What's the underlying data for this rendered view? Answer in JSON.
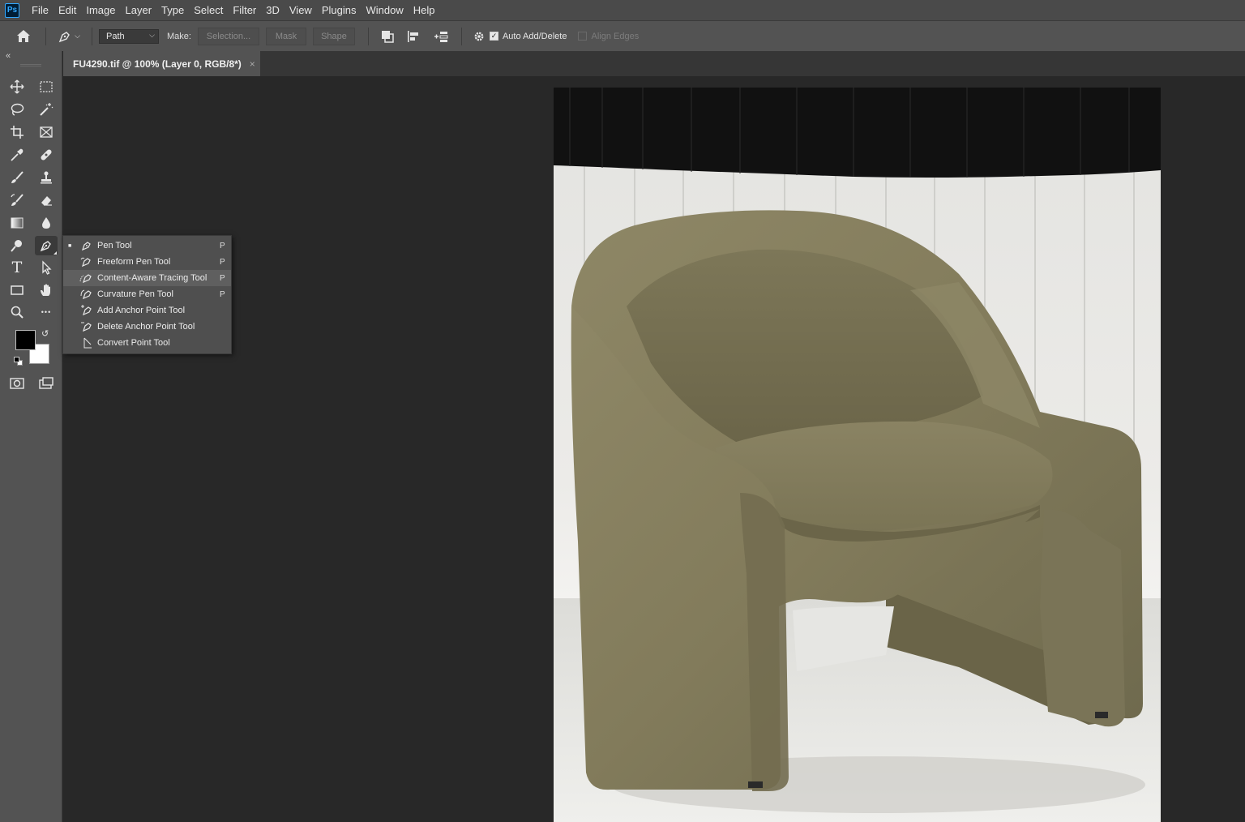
{
  "menubar": {
    "logo": "Ps",
    "items": [
      "File",
      "Edit",
      "Image",
      "Layer",
      "Type",
      "Select",
      "Filter",
      "3D",
      "View",
      "Plugins",
      "Window",
      "Help"
    ]
  },
  "options": {
    "mode_value": "Path",
    "make_label": "Make:",
    "selection_button": "Selection...",
    "mask_button": "Mask",
    "shape_button": "Shape",
    "auto_add_delete_label": "Auto Add/Delete",
    "auto_add_delete_checked": true,
    "align_edges_label": "Align Edges",
    "align_edges_checked": false
  },
  "toolbar": {
    "collapse_glyph": "«",
    "tools": [
      {
        "name": "move-tool",
        "icon": "move-icon"
      },
      {
        "name": "rectangular-marquee-tool",
        "icon": "marquee-icon"
      },
      {
        "name": "lasso-tool",
        "icon": "lasso-icon"
      },
      {
        "name": "magic-wand-tool",
        "icon": "magic-wand-icon"
      },
      {
        "name": "crop-tool",
        "icon": "crop-icon"
      },
      {
        "name": "frame-tool",
        "icon": "frame-icon"
      },
      {
        "name": "eyedropper-tool",
        "icon": "eyedropper-icon"
      },
      {
        "name": "healing-brush-tool",
        "icon": "bandage-icon"
      },
      {
        "name": "brush-tool",
        "icon": "brush-icon"
      },
      {
        "name": "clone-stamp-tool",
        "icon": "stamp-icon"
      },
      {
        "name": "history-brush-tool",
        "icon": "history-brush-icon"
      },
      {
        "name": "eraser-tool",
        "icon": "eraser-icon"
      },
      {
        "name": "gradient-tool",
        "icon": "gradient-icon"
      },
      {
        "name": "blur-tool",
        "icon": "drop-icon"
      },
      {
        "name": "dodge-tool",
        "icon": "dodge-icon"
      },
      {
        "name": "pen-tool",
        "icon": "pen-icon"
      },
      {
        "name": "type-tool",
        "icon": "type-icon",
        "glyph": "T"
      },
      {
        "name": "path-selection-tool",
        "icon": "arrow-icon"
      },
      {
        "name": "rectangle-tool",
        "icon": "rectangle-icon"
      },
      {
        "name": "hand-tool",
        "icon": "hand-icon"
      },
      {
        "name": "zoom-tool",
        "icon": "magnifier-icon"
      },
      {
        "name": "more-tools",
        "icon": "ellipsis-icon",
        "glyph": "•••"
      }
    ],
    "foreground_color": "#000000",
    "background_color": "#ffffff"
  },
  "document": {
    "tab_title": "FU4290.tif @ 100% (Layer 0, RGB/8*)",
    "close_glyph": "×"
  },
  "flyout": {
    "items": [
      {
        "label": "Pen Tool",
        "key": "P",
        "current": true
      },
      {
        "label": "Freeform Pen Tool",
        "key": "P"
      },
      {
        "label": "Content-Aware Tracing Tool",
        "key": "P",
        "highlighted": true
      },
      {
        "label": "Curvature Pen Tool",
        "key": "P"
      },
      {
        "label": "Add Anchor Point Tool",
        "key": ""
      },
      {
        "label": "Delete Anchor Point Tool",
        "key": ""
      },
      {
        "label": "Convert Point Tool",
        "key": ""
      }
    ],
    "bullet_glyph": "■"
  },
  "colors": {
    "menubar_bg": "#4a4a4a",
    "panel_bg": "#535353",
    "canvas_bg": "#282828",
    "chair_fabric": "#857e5e"
  }
}
